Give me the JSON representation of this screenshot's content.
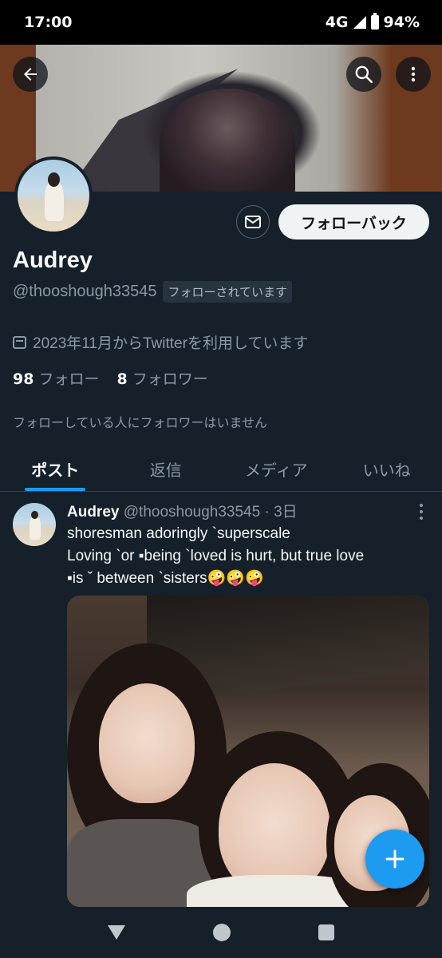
{
  "status_bar": {
    "time": "17:00",
    "network": "4G",
    "battery": "94%"
  },
  "profile": {
    "name": "Audrey",
    "handle": "@thooshough33545",
    "follows_you_badge": "フォローされています",
    "follow_back_label": "フォローバック",
    "joined": "2023年11月からTwitterを利用しています",
    "following_count": "98",
    "following_label": "フォロー",
    "followers_count": "8",
    "followers_label": "フォロワー",
    "mutual_note": "フォローしている人にフォロワーはいません"
  },
  "tabs": [
    {
      "label": "ポスト",
      "active": true
    },
    {
      "label": "返信",
      "active": false
    },
    {
      "label": "メディア",
      "active": false
    },
    {
      "label": "いいね",
      "active": false
    }
  ],
  "tweet": {
    "name": "Audrey",
    "meta": "@thooshough33545 · 3日",
    "line1": "shoresman adoringly `superscale",
    "line2": "Loving `or ▪being `loved is hurt, but true love",
    "line3": "▪is ˇ between `sisters🤪🤪🤪"
  },
  "colors": {
    "accent": "#1d9bf0",
    "background": "#15202b",
    "muted": "#8b98a5"
  },
  "icons": [
    "back-arrow-icon",
    "search-icon",
    "more-vertical-icon",
    "mail-icon",
    "calendar-icon",
    "plus-icon"
  ]
}
